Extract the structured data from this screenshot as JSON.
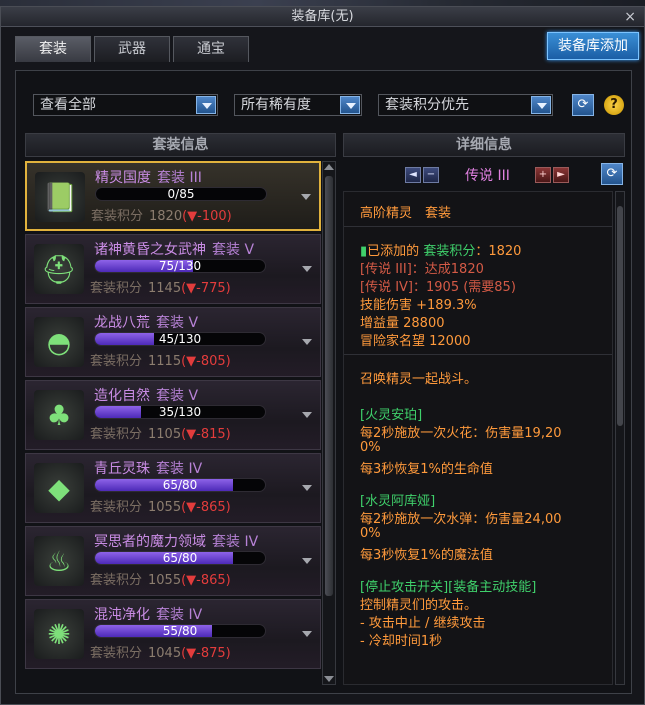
{
  "window": {
    "title": "装备库(无)",
    "close_label": "×"
  },
  "tabs": [
    {
      "label": "套装"
    },
    {
      "label": "武器"
    },
    {
      "label": "通宝"
    }
  ],
  "add_button": "装备库添加",
  "filters": {
    "view": "查看全部",
    "rarity": "所有稀有度",
    "sort": "套装积分优先",
    "refresh": "⟳",
    "help": "?"
  },
  "left_panel": {
    "heading": "套装信息",
    "score_label": "套装积分",
    "sets": [
      {
        "name": "精灵国度",
        "tier": "套装 III",
        "progress_text": "0/85",
        "progress": 0.0,
        "score": "1820",
        "delta": "(▼-100)",
        "selected": true,
        "icon": "book-icon"
      },
      {
        "name": "诸神黄昏之女武神",
        "tier": "套装 V",
        "progress_text": "75/130",
        "progress": 0.577,
        "score": "1145",
        "delta": "(▼-775)",
        "selected": false,
        "icon": "helmet-icon"
      },
      {
        "name": "龙战八荒",
        "tier": "套装 V",
        "progress_text": "45/130",
        "progress": 0.346,
        "score": "1115",
        "delta": "(▼-805)",
        "selected": false,
        "icon": "sunrise-icon"
      },
      {
        "name": "造化自然",
        "tier": "套装 V",
        "progress_text": "35/130",
        "progress": 0.269,
        "score": "1105",
        "delta": "(▼-815)",
        "selected": false,
        "icon": "tree-icon"
      },
      {
        "name": "青丘灵珠",
        "tier": "套装 IV",
        "progress_text": "65/80",
        "progress": 0.8125,
        "score": "1055",
        "delta": "(▼-865)",
        "selected": false,
        "icon": "fox-icon"
      },
      {
        "name": "冥思者的魔力领域",
        "tier": "套装 IV",
        "progress_text": "65/80",
        "progress": 0.8125,
        "score": "1055",
        "delta": "(▼-865)",
        "selected": false,
        "icon": "flame-icon"
      },
      {
        "name": "混沌净化",
        "tier": "套装 IV",
        "progress_text": "55/80",
        "progress": 0.6875,
        "score": "1045",
        "delta": "(▼-875)",
        "selected": false,
        "icon": "spiral-icon"
      }
    ]
  },
  "right_panel": {
    "heading": "详细信息",
    "grade": "传说 III",
    "prev": "◄",
    "next": "►",
    "minus": "−",
    "plus": "+",
    "refresh": "⟳",
    "set_title": "高阶精灵　套装",
    "added_label": "已添加的",
    "added_score_label": "套装积分",
    "added_score": "：1820",
    "legend_reached": "[传说 III]：达成1820",
    "legend_next": "[传说 IV]：1905 (需要85)",
    "skill_damage": "技能伤害 +189.3%",
    "benefit": "增益量 28800",
    "adventurer_fame": "冒险家名望 12000",
    "summon_desc": "召唤精灵一起战斗。",
    "fire_title": "[火灵安珀]",
    "fire_line1": "每2秒施放一次火花：伤害量19,20",
    "fire_line2": "0%",
    "fire_line3": "每3秒恢复1%的生命值",
    "water_title": "[水灵阿库娅]",
    "water_line1": "每2秒施放一次水弹：伤害量24,00",
    "water_line2": "0%",
    "water_line3": "每3秒恢复1%的魔法值",
    "toggle_title": "[停止攻击开关][装备主动技能]",
    "toggle_line1": "控制精灵们的攻击。",
    "toggle_line2": "- 攻击中止 / 继续攻击",
    "toggle_line3": "- 冷却时间1秒"
  },
  "colors": {
    "accent_blue": "#2f7fd0",
    "selected_border": "#e1b23d",
    "set_name": "#c98ce4",
    "progress_fill": "#7a52e0",
    "delta_red": "#e33c3c",
    "detail_orange": "#ff9a3c",
    "detail_green": "#3fd06b",
    "detail_red": "#d45a46"
  }
}
